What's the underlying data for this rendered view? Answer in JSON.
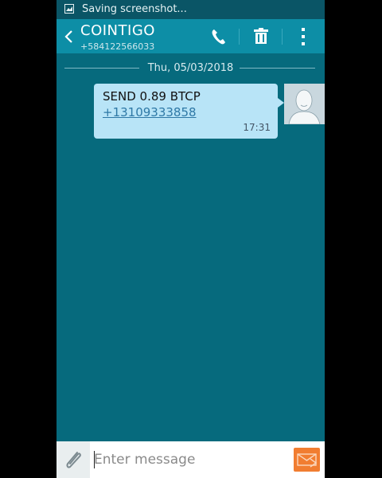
{
  "status_bar": {
    "text": "Saving screenshot..."
  },
  "app_bar": {
    "contact_name": "COINTIGO",
    "contact_number": "+584122566033"
  },
  "conversation": {
    "date": "Thu, 05/03/2018",
    "messages": [
      {
        "text": "SEND 0.89 BTCP",
        "link": "+13109333858",
        "time": "17:31"
      }
    ]
  },
  "composer": {
    "placeholder": "Enter message"
  },
  "colors": {
    "background": "#066a7d",
    "app_bar": "#0d8ea6",
    "bubble": "#b8e4f7",
    "send_button": "#f17d31"
  }
}
